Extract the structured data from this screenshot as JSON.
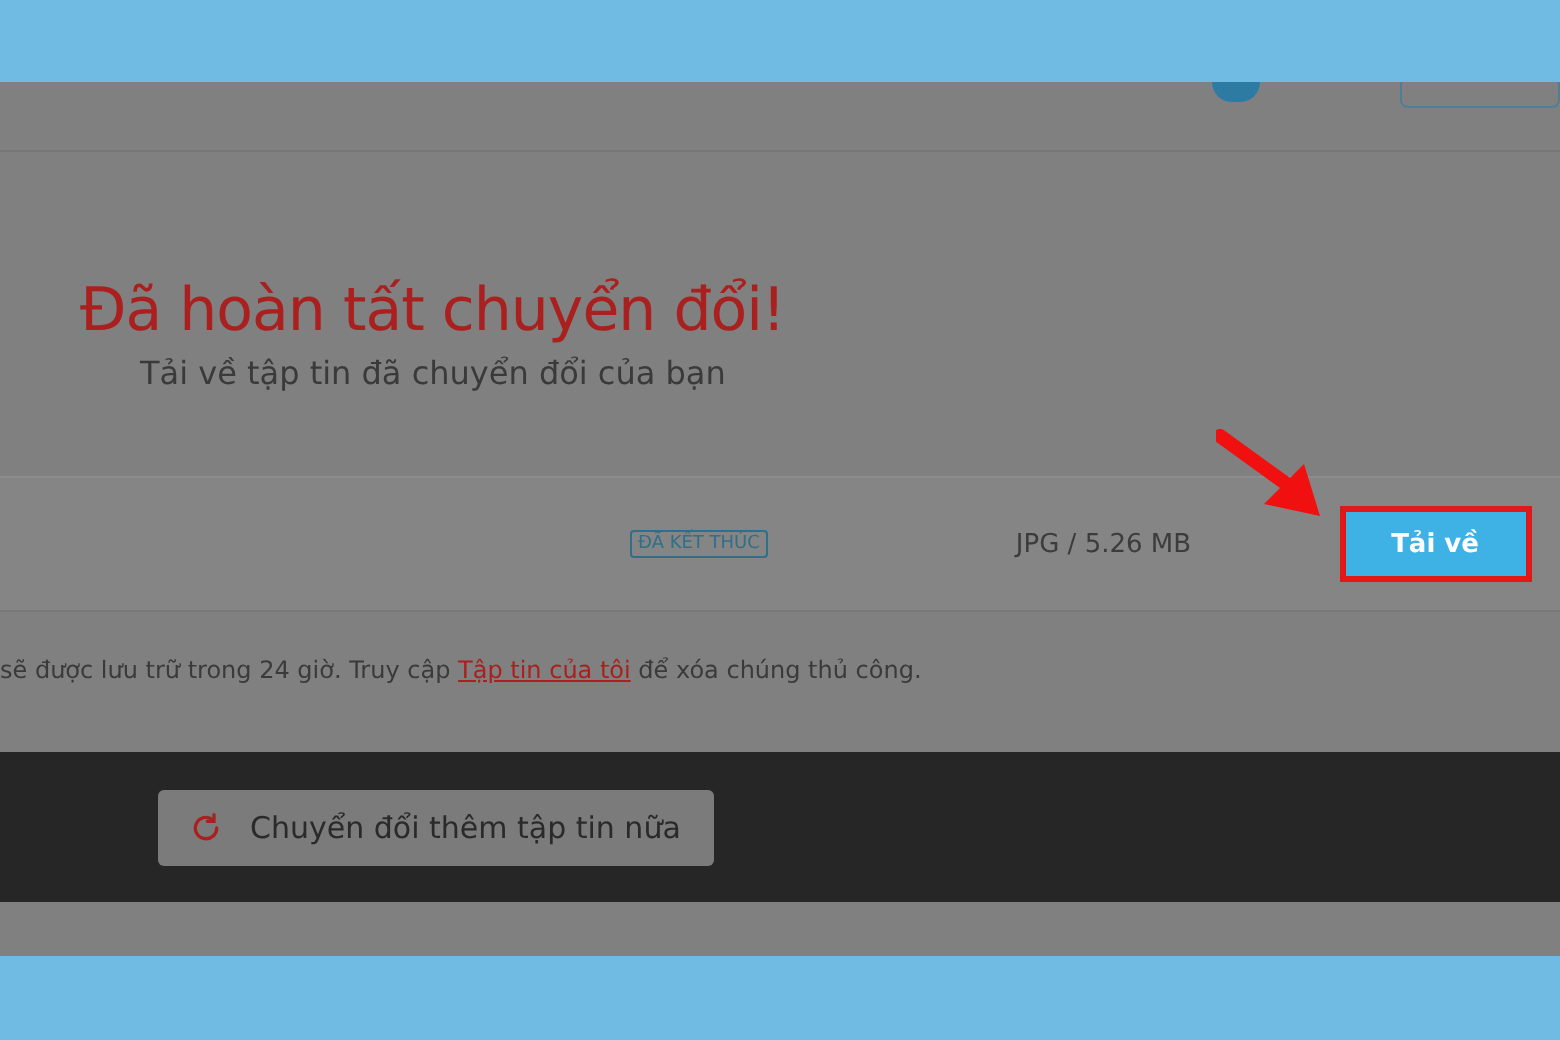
{
  "header": {
    "files_badge": true
  },
  "hero": {
    "title": "Đã hoàn tất chuyển đổi!",
    "subtitle": "Tải về tập tin đã chuyển đổi của bạn"
  },
  "file_row": {
    "status": "ĐÃ KẾT THÚC",
    "info": "JPG / 5.26 MB",
    "download_button": "Tải về",
    "highlighted": true
  },
  "notice": {
    "before": "sẽ được lưu trữ trong 24 giờ. Truy cập ",
    "link": "Tập tin của tôi",
    "after": " để xóa chúng thủ công."
  },
  "convert_more_button": "Chuyển đổi thêm tập tin nữa"
}
